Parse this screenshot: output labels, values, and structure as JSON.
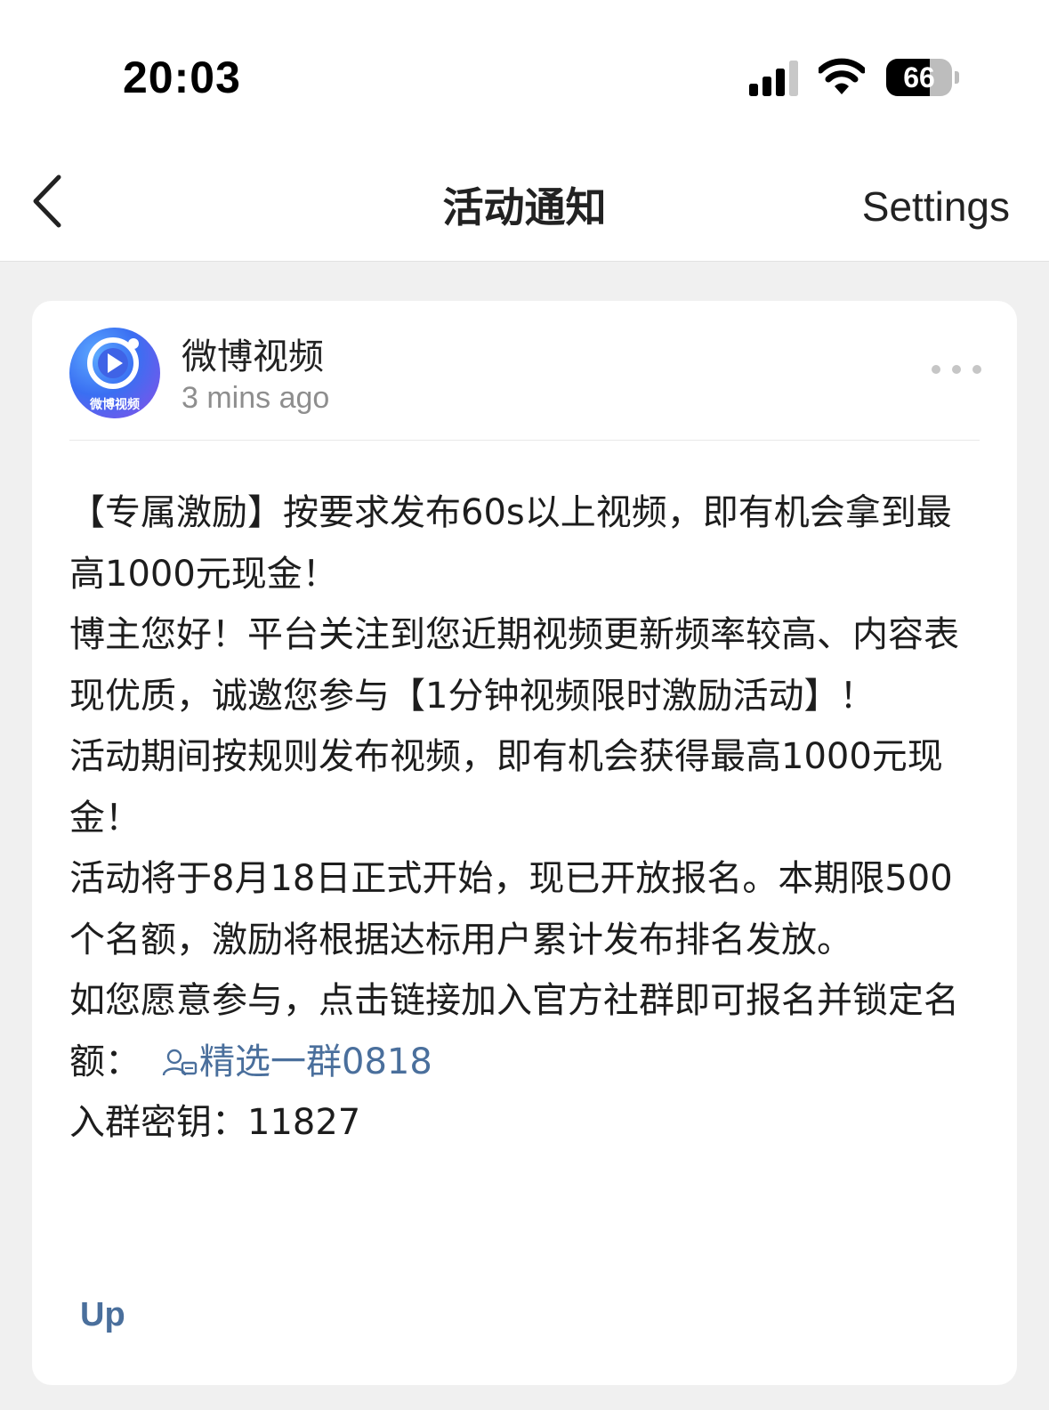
{
  "status_bar": {
    "time": "20:03",
    "battery_level": "66",
    "battery_fraction": 0.66,
    "icons": [
      "signal-icon",
      "wifi-icon",
      "battery-icon"
    ]
  },
  "nav": {
    "back_icon": "chevron-left-icon",
    "title": "活动通知",
    "settings_label": "Settings"
  },
  "message": {
    "avatar_text": "微博视频",
    "sender": "微博视频",
    "time": "3 mins ago",
    "more_icon": "more-horizontal-icon",
    "paragraphs": {
      "p1": "【专属激励】按要求发布60s以上视频，即有机会拿到最高1000元现金！",
      "p2": "博主您好！平台关注到您近期视频更新频率较高、内容表现优质，诚邀您参与【1分钟视频限时激励活动】！",
      "p3": "活动期间按规则发布视频，即有机会获得最高1000元现金！",
      "p4": "活动将于8月18日正式开始，现已开放报名。本期限500个名额，激励将根据达标用户累计发布排名发放。",
      "p5_text": "如您愿意参与，点击链接加入官方社群即可报名并锁定名额：",
      "p5_link": "精选一群0818",
      "p6": "入群密钥：11827"
    },
    "link_icon": "group-chat-icon",
    "up_label": "Up"
  },
  "colors": {
    "link": "#4a6f9c",
    "background": "#f0f0f0",
    "card": "#ffffff"
  }
}
